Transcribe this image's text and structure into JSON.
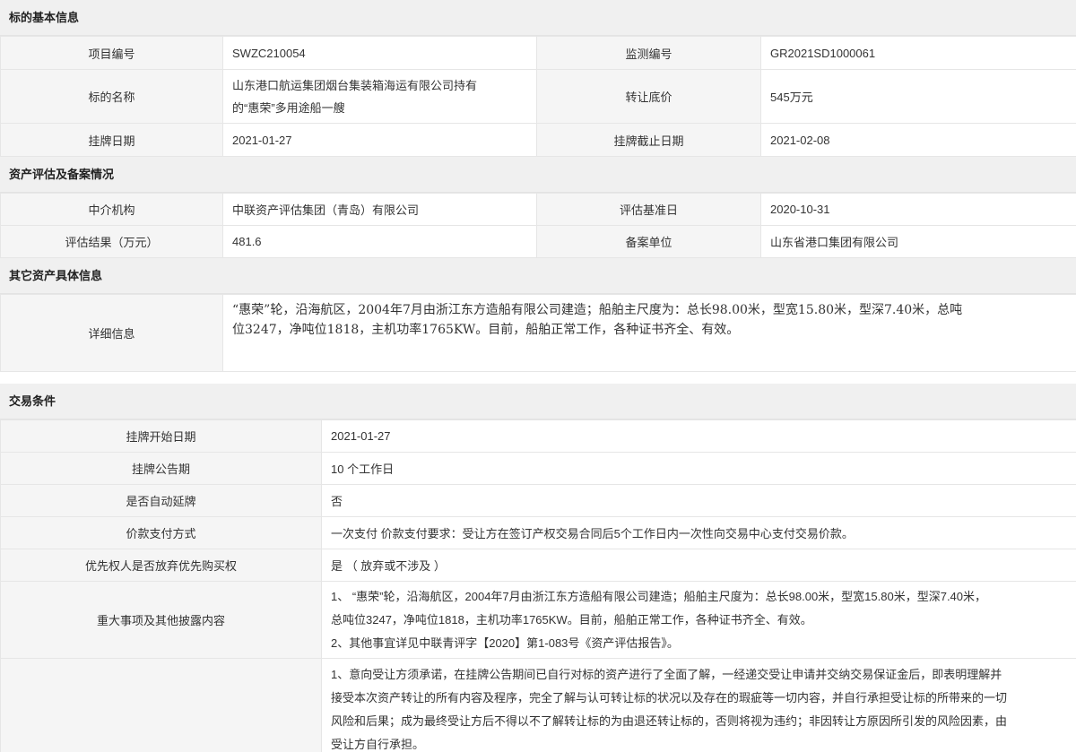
{
  "basic": {
    "title": "标的基本信息",
    "project_no_label": "项目编号",
    "project_no": "SWZC210054",
    "monitor_no_label": "监测编号",
    "monitor_no": "GR2021SD1000061",
    "name_label": "标的名称",
    "name_line1": "山东港口航运集团烟台集装箱海运有限公司持有",
    "name_line2": "的“惠荣”多用途船一艘",
    "price_label": "转让底价",
    "price": "545万元",
    "listing_date_label": "挂牌日期",
    "listing_date": "2021-01-27",
    "end_date_label": "挂牌截止日期",
    "end_date": "2021-02-08"
  },
  "assessment": {
    "title": "资产评估及备案情况",
    "agency_label": "中介机构",
    "agency": "中联资产评估集团（青岛）有限公司",
    "base_date_label": "评估基准日",
    "base_date": "2020-10-31",
    "result_label": "评估结果（万元）",
    "result": "481.6",
    "filing_label": "备案单位",
    "filing": "山东省港口集团有限公司"
  },
  "other": {
    "title": "其它资产具体信息",
    "detail_label": "详细信息",
    "detail_line1": "“惠荣”轮，沿海航区，2004年7月由浙江东方造船有限公司建造；船舶主尺度为：总长98.00米，型宽15.80米，型深7.40米，总吨",
    "detail_line2": "位3247，净吨位1818，主机功率1765KW。目前，船舶正常工作，各种证书齐全、有效。"
  },
  "trade": {
    "title": "交易条件",
    "start_date_label": "挂牌开始日期",
    "start_date": "2021-01-27",
    "notice_period_label": "挂牌公告期",
    "notice_period": "10 个工作日",
    "auto_extend_label": "是否自动延牌",
    "auto_extend": "否",
    "payment_label": "价款支付方式",
    "payment": "一次支付 价款支付要求：受让方在签订产权交易合同后5个工作日内一次性向交易中心支付交易价款。",
    "priority_label": "优先权人是否放弃优先购买权",
    "priority": "是 （ 放弃或不涉及 ）",
    "disclosure_label": "重大事项及其他披露内容",
    "disclosure_line1": "1、 “惠荣”轮，沿海航区，2004年7月由浙江东方造船有限公司建造；船舶主尺度为：总长98.00米，型宽15.80米，型深7.40米，",
    "disclosure_line2": "总吨位3247，净吨位1818，主机功率1765KW。目前，船舶正常工作，各种证书齐全、有效。",
    "disclosure_line3": "2、其他事宜详见中联青评字【2020】第1-083号《资产评估报告》。",
    "commit_line1": "1、意向受让方须承诺，在挂牌公告期间已自行对标的资产进行了全面了解，一经递交受让申请并交纳交易保证金后，即表明理解并",
    "commit_line2": "接受本次资产转让的所有内容及程序，完全了解与认可转让标的状况以及存在的瑕疵等一切内容，并自行承担受让标的所带来的一切",
    "commit_line3": "风险和后果；成为最终受让方后不得以不了解转让标的为由退还转让标的，否则将视为违约；非因转让方原因所引发的风险因素，由",
    "commit_line4": "受让方自行承担。"
  }
}
